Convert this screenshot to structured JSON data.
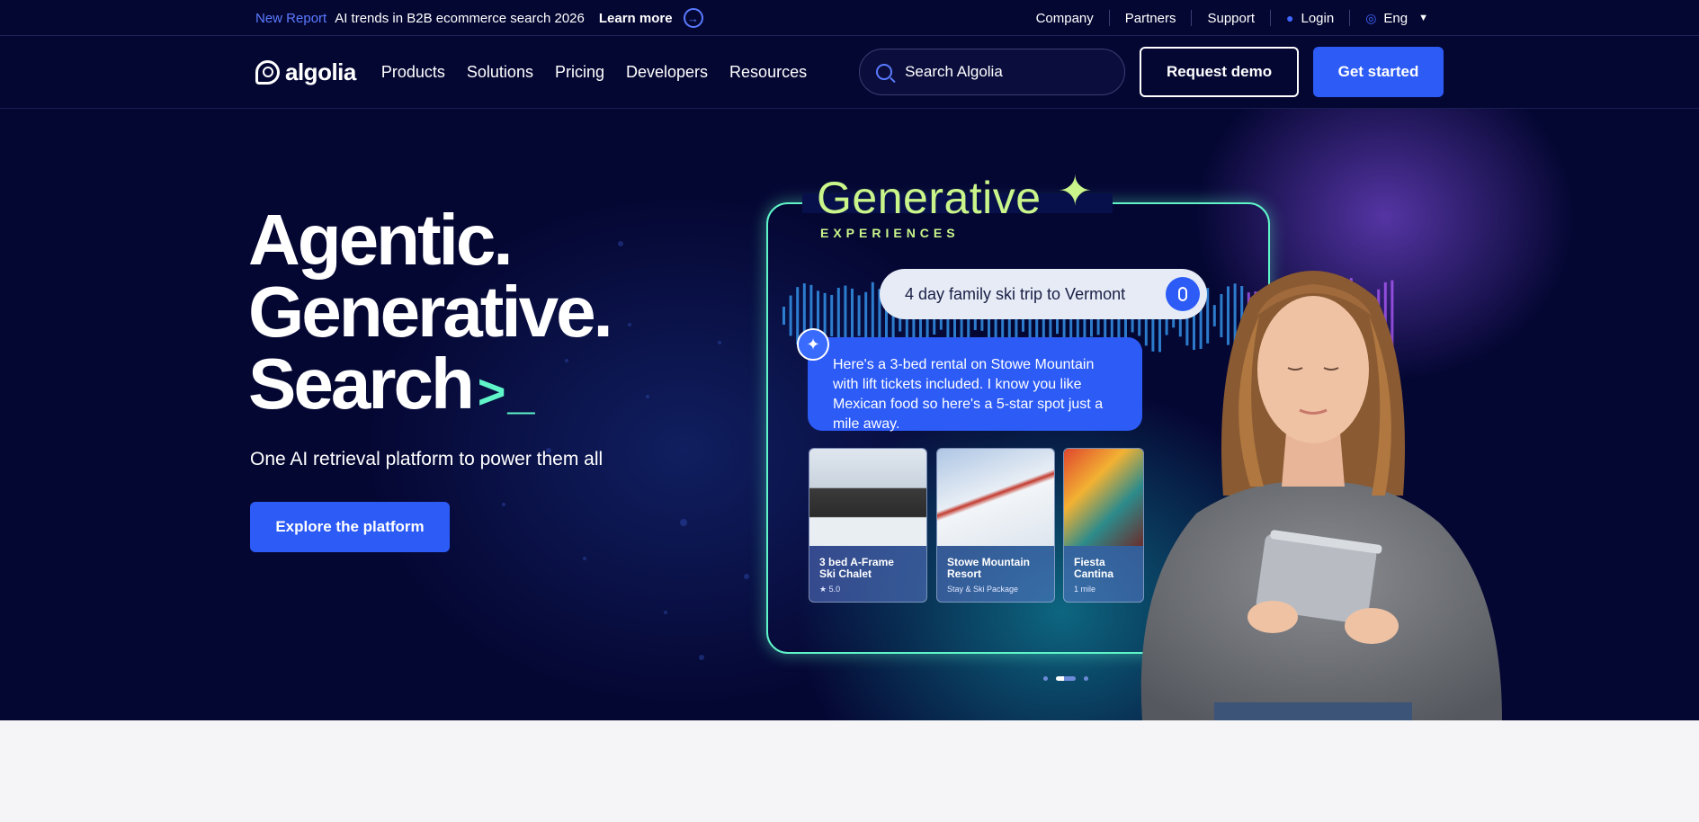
{
  "topbar": {
    "tag": "New Report",
    "announcement": "AI trends in B2B ecommerce search 2026",
    "learn_more": "Learn more",
    "links": [
      "Company",
      "Partners",
      "Support"
    ],
    "login": "Login",
    "language": "Eng"
  },
  "nav": {
    "logo": "algolia",
    "items": [
      "Products",
      "Solutions",
      "Pricing",
      "Developers",
      "Resources"
    ],
    "search_placeholder": "Search Algolia",
    "request_demo": "Request demo",
    "get_started": "Get started"
  },
  "hero": {
    "line1": "Agentic.",
    "line2": "Generative.",
    "line3": "Search",
    "cursor": ">_",
    "subtitle": "One AI retrieval platform to power them all",
    "cta": "Explore the platform"
  },
  "illustration": {
    "title": "Generative",
    "subtitle": "EXPERIENCES",
    "query": "4 day family ski trip to Vermont",
    "answer": "Here's a 3-bed rental on Stowe Mountain with lift tickets included. I know you like Mexican food so here's a 5-star spot just a mile away.",
    "cards": [
      {
        "name": "3 bed A-Frame Ski Chalet",
        "meta": "★ 5.0"
      },
      {
        "name": "Stowe Mountain Resort",
        "meta": "Stay & Ski Package"
      },
      {
        "name": "Fiesta Cantina",
        "meta": "1 mile"
      }
    ],
    "carousel": {
      "count": 3,
      "active": 1
    }
  },
  "colors": {
    "background": "#050733",
    "accent": "#2c5bf6",
    "highlight": "#5ff5c9",
    "generative": "#c9f58a"
  }
}
